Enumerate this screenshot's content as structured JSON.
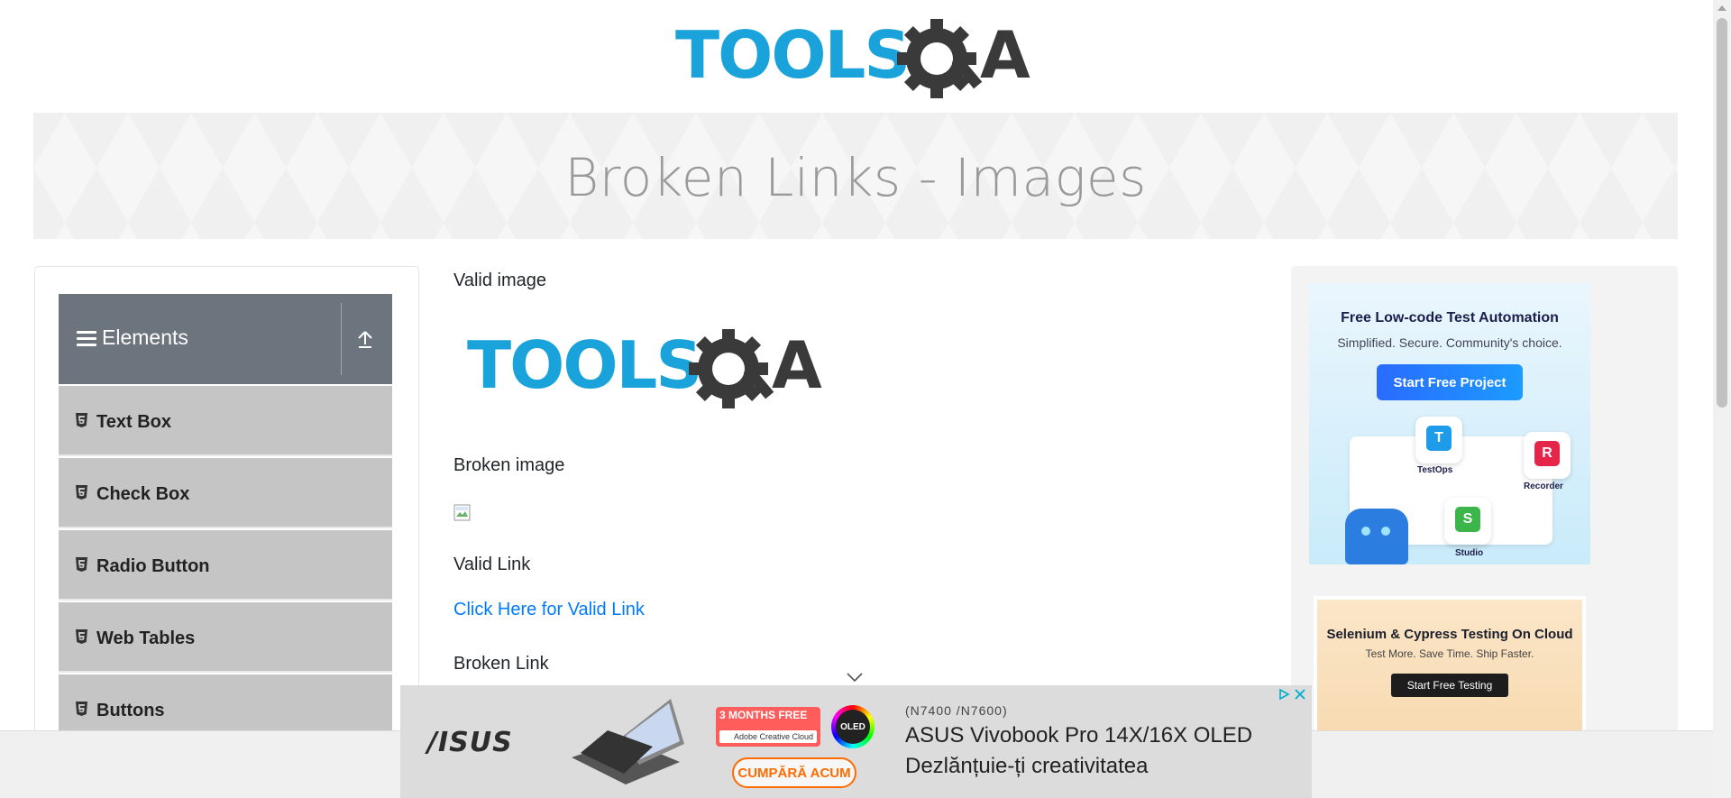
{
  "header": {
    "logo_text": "TOOLSQA",
    "page_title": "Broken Links - Images"
  },
  "sidebar": {
    "group_title": "Elements",
    "items": [
      {
        "label": "Text Box"
      },
      {
        "label": "Check Box"
      },
      {
        "label": "Radio Button"
      },
      {
        "label": "Web Tables"
      },
      {
        "label": "Buttons"
      }
    ]
  },
  "main": {
    "valid_image_label": "Valid image",
    "valid_image_logo_text": "TOOLSQA",
    "broken_image_label": "Broken image",
    "valid_link_label": "Valid Link",
    "valid_link_text": "Click Here for Valid Link",
    "broken_link_label": "Broken Link"
  },
  "ads": {
    "katalon": {
      "headline": "Free Low-code Test Automation",
      "subline": "Simplified. Secure. Community's choice.",
      "button": "Start Free Project",
      "tiles": [
        "TestOps",
        "Recorder",
        "Studio"
      ],
      "tile_letters": [
        "T",
        "R",
        "S"
      ]
    },
    "cloud": {
      "headline": "Selenium & Cypress Testing On Cloud",
      "subline": "Test More. Save Time. Ship Faster.",
      "button": "Start Free Testing"
    },
    "bottom": {
      "brand": "/ISUS",
      "promo_line1": "3 MONTHS FREE",
      "promo_line2": "Adobe Creative Cloud",
      "oled": "OLED",
      "cta": "CUMPĂRĂ ACUM",
      "model": "(N7400 /N7600)",
      "title": "ASUS Vivobook Pro 14X/16X OLED",
      "tagline": "Dezlănțuie-ți creativitatea"
    }
  },
  "colors": {
    "logo_blue": "#1aa3db",
    "logo_dark": "#3a3a3a",
    "sidebar_header": "#6c757d",
    "menu_item_bg": "#c5c5c5",
    "link": "#007bff"
  }
}
